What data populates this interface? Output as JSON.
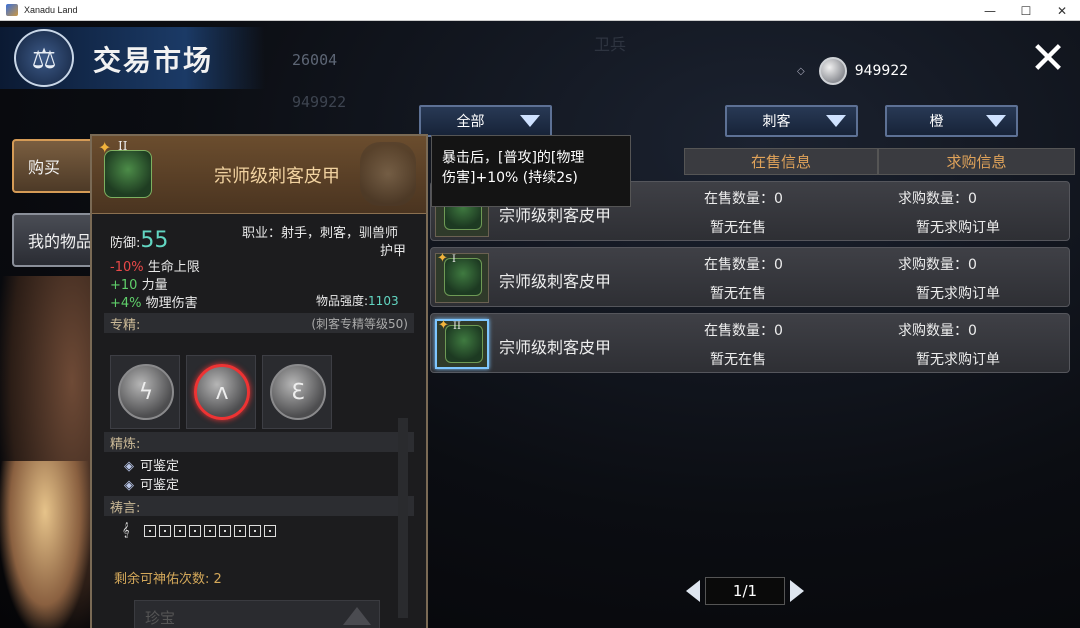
{
  "window": {
    "title": "Xanadu Land",
    "minimize": "—",
    "maximize": "☐",
    "close": "✕"
  },
  "header": {
    "title": "交易市场",
    "emblem_icon": "scales-icon",
    "close_icon": "✕"
  },
  "background": {
    "number_1": "26004",
    "number_2": "949922",
    "sign": "卫兵"
  },
  "currency": {
    "amount": "949922",
    "icon": "silver-coin-icon"
  },
  "side_tabs": [
    {
      "label": "购买",
      "active": true
    },
    {
      "label": "我的物品",
      "active": false
    }
  ],
  "filters": {
    "category": "全部",
    "class": "刺客",
    "rarity": "橙"
  },
  "table": {
    "headers": {
      "sale": "在售信息",
      "buy": "求购信息"
    },
    "rows": [
      {
        "name": "宗师级刺客皮甲",
        "tier": "",
        "sale_count": "在售数量：0",
        "sale_status": "暂无在售",
        "buy_count": "求购数量：0",
        "buy_status": "暂无求购订单"
      },
      {
        "name": "宗师级刺客皮甲",
        "tier": "I",
        "sale_count": "在售数量：0",
        "sale_status": "暂无在售",
        "buy_count": "求购数量：0",
        "buy_status": "暂无求购订单"
      },
      {
        "name": "宗师级刺客皮甲",
        "tier": "II",
        "sale_count": "在售数量：0",
        "sale_status": "暂无在售",
        "buy_count": "求购数量：0",
        "buy_status": "暂无求购订单"
      }
    ]
  },
  "pagination": {
    "page": "1/1"
  },
  "item_tooltip": {
    "tier": "II",
    "name": "宗师级刺客皮甲",
    "defense_label": "防御:",
    "defense_value": "55",
    "profession": "职业：射手，刺客，驯兽师",
    "type": "护甲",
    "stats": [
      {
        "value": "-10%",
        "label": "生命上限",
        "color": "red"
      },
      {
        "value": "+10",
        "label": "力量",
        "color": "green"
      },
      {
        "value": "+4%",
        "label": "物理伤害",
        "color": "green"
      }
    ],
    "strength_label": "物品强度:",
    "strength_value": "1103",
    "spec_label": "专精:",
    "spec_level": "(刺客专精等级50)",
    "refine_label": "精炼:",
    "refine_items": [
      "可鉴定",
      "可鉴定"
    ],
    "prayer_label": "祷言:",
    "remain_text": "剩余可神佑次数: 2",
    "faded_button": "珍宝"
  },
  "skill_tooltip": {
    "line1": "暴击后，[普攻]的[物理",
    "line2": "伤害]+10% (持续2s)"
  }
}
